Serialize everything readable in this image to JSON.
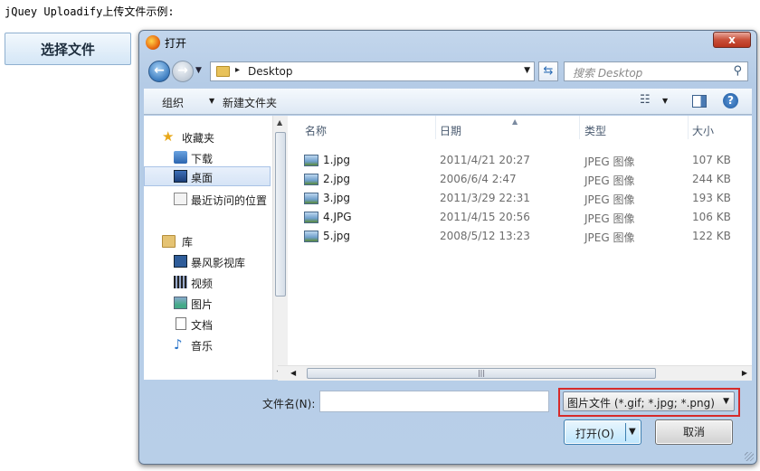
{
  "page": {
    "caption": "jQuey Uploadify上传文件示例:",
    "choose_button": "选择文件"
  },
  "dialog": {
    "title": "打开",
    "close": "x",
    "address": {
      "location": "Desktop",
      "separator": "▸"
    },
    "search_placeholder": "搜索 Desktop",
    "toolbar": {
      "organize": "组织",
      "new_folder": "新建文件夹",
      "help": "?"
    },
    "nav": {
      "favorites": "收藏夹",
      "downloads": "下载",
      "desktop": "桌面",
      "recent": "最近访问的位置",
      "libraries": "库",
      "storm_video": "暴风影视库",
      "videos": "视频",
      "pictures": "图片",
      "documents": "文档",
      "music": "音乐"
    },
    "columns": {
      "name": "名称",
      "date": "日期",
      "type": "类型",
      "size": "大小"
    },
    "files": [
      {
        "name": "1.jpg",
        "date": "2011/4/21 20:27",
        "type": "JPEG 图像",
        "size": "107 KB"
      },
      {
        "name": "2.jpg",
        "date": "2006/6/4 2:47",
        "type": "JPEG 图像",
        "size": "244 KB"
      },
      {
        "name": "3.jpg",
        "date": "2011/3/29 22:31",
        "type": "JPEG 图像",
        "size": "193 KB"
      },
      {
        "name": "4.JPG",
        "date": "2011/4/15 20:56",
        "type": "JPEG 图像",
        "size": "106 KB"
      },
      {
        "name": "5.jpg",
        "date": "2008/5/12 13:23",
        "type": "JPEG 图像",
        "size": "122 KB"
      }
    ],
    "filename_label": "文件名(N):",
    "filename_value": "",
    "filetype": "图片文件 (*.gif; *.jpg; *.png)",
    "open_button": "打开(O)",
    "cancel_button": "取消"
  },
  "colors": {
    "highlight_frame": "#d62a2a",
    "selected_nav": "#d6e4f6",
    "dialog_frame": "#b8cfe8"
  }
}
